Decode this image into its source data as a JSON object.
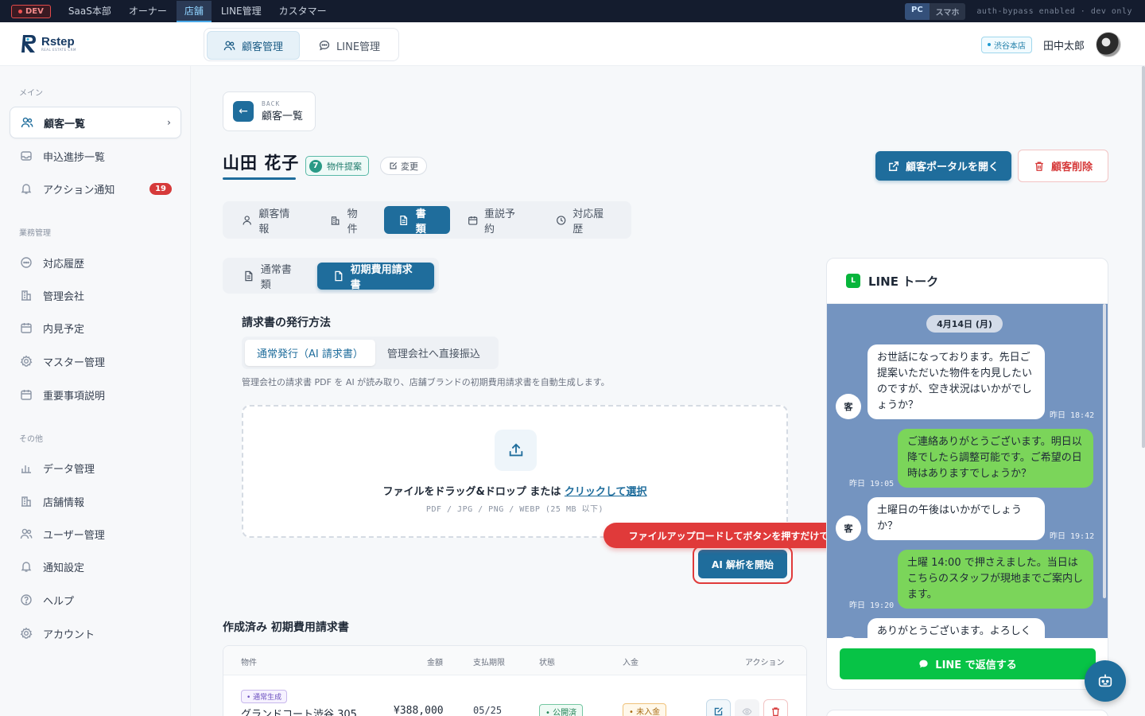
{
  "devbar": {
    "badge": "DEV",
    "tabs": [
      "SaaS本部",
      "オーナー",
      "店舗",
      "LINE管理",
      "カスタマー"
    ],
    "active_tab": "店舗",
    "view_pc": "PC",
    "view_sp": "スマホ",
    "note": "auth-bypass enabled · dev only"
  },
  "header": {
    "logo_text": "Rstep",
    "logo_sub": "REAL ESTATE CRM",
    "nav": [
      {
        "label": "顧客管理",
        "icon": "users-icon"
      },
      {
        "label": "LINE管理",
        "icon": "chat-bubble-icon"
      }
    ],
    "store_badge": "渋谷本店",
    "user_name": "田中太郎"
  },
  "sidebar": {
    "sections": [
      {
        "title": "メイン",
        "items": [
          {
            "label": "顧客一覧",
            "icon": "users-icon",
            "active": true
          },
          {
            "label": "申込進捗一覧",
            "icon": "inbox-icon"
          },
          {
            "label": "アクション通知",
            "icon": "bell-icon",
            "badge": "19"
          }
        ]
      },
      {
        "title": "業務管理",
        "items": [
          {
            "label": "対応履歴",
            "icon": "chat-bubble-icon"
          },
          {
            "label": "管理会社",
            "icon": "building-icon"
          },
          {
            "label": "内見予定",
            "icon": "calendar-icon"
          },
          {
            "label": "マスター管理",
            "icon": "gear-icon"
          },
          {
            "label": "重要事項説明",
            "icon": "calendar-icon"
          }
        ]
      },
      {
        "title": "その他",
        "items": [
          {
            "label": "データ管理",
            "icon": "bar-chart-icon"
          },
          {
            "label": "店舗情報",
            "icon": "building-icon"
          },
          {
            "label": "ユーザー管理",
            "icon": "users-icon"
          },
          {
            "label": "通知設定",
            "icon": "bell-icon"
          },
          {
            "label": "ヘルプ",
            "icon": "help-icon"
          },
          {
            "label": "アカウント",
            "icon": "gear-icon"
          }
        ]
      }
    ]
  },
  "main": {
    "back_small": "BACK",
    "back_label": "顧客一覧",
    "customer_name": "山田 花子",
    "status_num": "7",
    "status_label": "物件提案",
    "change_label": "変更",
    "portal_button": "顧客ポータルを開く",
    "delete_button": "顧客削除",
    "tabs": [
      "顧客情報",
      "物件",
      "書類",
      "重説予約",
      "対応履歴"
    ],
    "active_tab": "書類",
    "subtabs": [
      "通常書類",
      "初期費用請求書"
    ],
    "active_subtab": "初期費用請求書",
    "issue_title": "請求書の発行方法",
    "issue_options": [
      "通常発行（AI 請求書）",
      "管理会社へ直接振込"
    ],
    "issue_desc": "管理会社の請求書 PDF を AI が読み取り、店舗ブランドの初期費用請求書を自動生成します。",
    "drop_text": "ファイルをドラッグ&ドロップ または ",
    "drop_link": "クリックして選択",
    "drop_hint": "PDF / JPG / PNG / WEBP (25 MB 以下)",
    "callout": "ファイルアップロードしてボタンを押すだけで自動生成",
    "ai_button": "AI 解析を開始",
    "made_title": "作成済み 初期費用請求書",
    "table": {
      "headers": [
        "物件",
        "金額",
        "支払期限",
        "状態",
        "入金",
        "アクション"
      ],
      "rows": [
        {
          "kind": "通常生成",
          "property": "グランドコート渋谷 305",
          "amount": "¥388,000",
          "due": "05/25",
          "status": "公開済",
          "payment": "未入金"
        }
      ]
    }
  },
  "line": {
    "title": "LINE トーク",
    "date": "4月14日 (月)",
    "avatar_label": "客",
    "messages": [
      {
        "dir": "in",
        "text": "お世話になっております。先日ご提案いただいた物件を内見したいのですが、空き状況はいかがでしょうか？",
        "time": "昨日 18:42"
      },
      {
        "dir": "out",
        "text": "ご連絡ありがとうございます。明日以降でしたら調整可能です。ご希望の日時はありますでしょうか？",
        "time": "昨日 19:05"
      },
      {
        "dir": "in",
        "text": "土曜日の午後はいかがでしょうか？",
        "time": "昨日 19:12"
      },
      {
        "dir": "out",
        "text": "土曜 14:00 で押さえました。当日はこちらのスタッフが現地までご案内します。",
        "time": "昨日 19:20"
      },
      {
        "dir": "in",
        "text": "ありがとうございます。よろしくお願いします。",
        "time": ""
      }
    ],
    "reply_button": "LINE で返信する"
  },
  "colors": {
    "primary": "#1f6d9c",
    "line_green": "#07c346",
    "danger": "#e03a3a"
  }
}
